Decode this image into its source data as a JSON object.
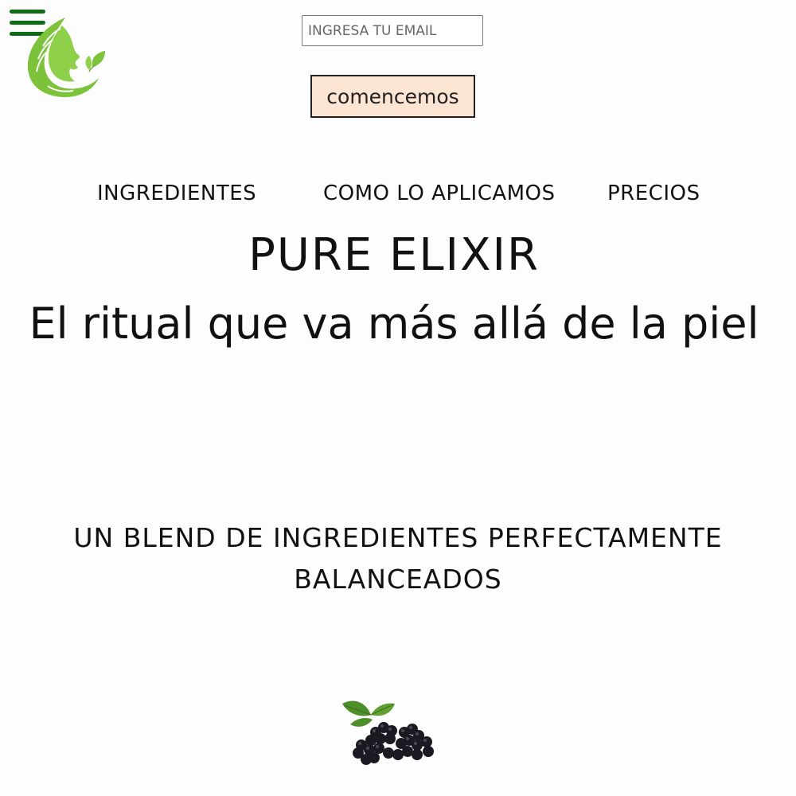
{
  "header": {
    "menu_icon": "hamburger-menu-icon",
    "logo_icon": "woman-leaf-profile-logo",
    "email_placeholder": "INGRESA TU EMAIL",
    "cta_label": "comencemos"
  },
  "nav": {
    "items": [
      {
        "label": "INGREDIENTES"
      },
      {
        "label": "COMO LO APLICAMOS"
      },
      {
        "label": "PRECIOS"
      }
    ]
  },
  "hero": {
    "title": "PURE ELIXIR",
    "subtitle": "El ritual que va más allá de la piel"
  },
  "ingredients": {
    "heading": "UN BLEND DE INGREDIENTES PERFECTAMENTE BALANCEADOS",
    "image_icon": "blackberries-image"
  },
  "colors": {
    "menu_green": "#0f6b16",
    "logo_green": "#7cc23a",
    "button_bg": "#fde5d4",
    "text": "#111111",
    "background": "#fdfdfd"
  }
}
